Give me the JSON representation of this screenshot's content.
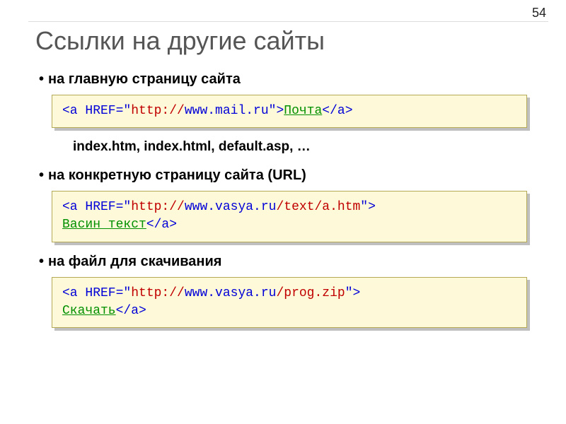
{
  "pageNumber": "54",
  "title": "Ссылки на другие сайты",
  "sections": {
    "s1": {
      "heading": "на главную страницу сайта"
    },
    "s2": {
      "heading": "на конкретную страницу сайта (URL)"
    },
    "s3": {
      "heading": "на файл для скачивания"
    }
  },
  "subNote": "index.htm, index.html, default.asp, …",
  "code1": {
    "open1": "<a HREF=\"",
    "proto": "http://",
    "host": "www.mail.ru",
    "open2": "\">",
    "text": "Почта",
    "close": "</a>"
  },
  "code2": {
    "line1_open": "<a HREF=\"",
    "line1_proto": "http://",
    "line1_host": "www.vasya.ru",
    "line1_path": "/text/a.htm",
    "line1_close": "\">",
    "line2_text": "Васин текст",
    "line2_close": "</a>"
  },
  "code3": {
    "line1_open": "<a HREF=\"",
    "line1_proto": "http://",
    "line1_host": "www.vasya.ru",
    "line1_path": "/prog.zip",
    "line1_close": "\">",
    "line2_text": "Скачать",
    "line2_close": "</a>"
  }
}
